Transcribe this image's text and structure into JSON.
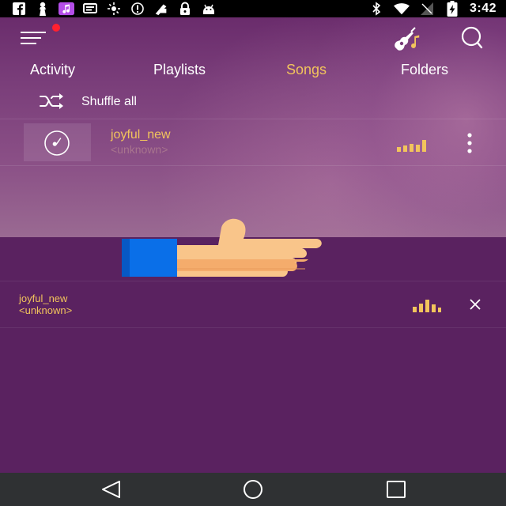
{
  "status_bar": {
    "time": "3:42",
    "icons": [
      "facebook-icon",
      "figure-icon",
      "music-app-icon",
      "notification-icon",
      "brightness-icon",
      "info-icon",
      "fax-icon",
      "lock-icon",
      "android-icon",
      "bluetooth-icon",
      "wifi-icon",
      "no-signal-icon",
      "battery-charging-icon"
    ]
  },
  "toolbar": {
    "menu_icon": "hamburger-icon",
    "notification_dot_color": "#ff2130",
    "guitar_icon": "guitar-icon",
    "search_icon": "search-icon"
  },
  "tabs": [
    {
      "label": "Activity",
      "active": false
    },
    {
      "label": "Playlists",
      "active": false
    },
    {
      "label": "Songs",
      "active": true
    },
    {
      "label": "Folders",
      "active": false
    }
  ],
  "shuffle": {
    "label": "Shuffle all",
    "icon": "shuffle-icon"
  },
  "songs": [
    {
      "title": "joyful_new",
      "artist": "<unknown>",
      "playing": true
    }
  ],
  "now_playing": {
    "title": "joyful_new",
    "artist": "<unknown>"
  },
  "colors": {
    "accent": "#f2c45c",
    "background": "#5a2260",
    "artist_text": "#a8748e",
    "nav_bar": "#2f3133"
  }
}
